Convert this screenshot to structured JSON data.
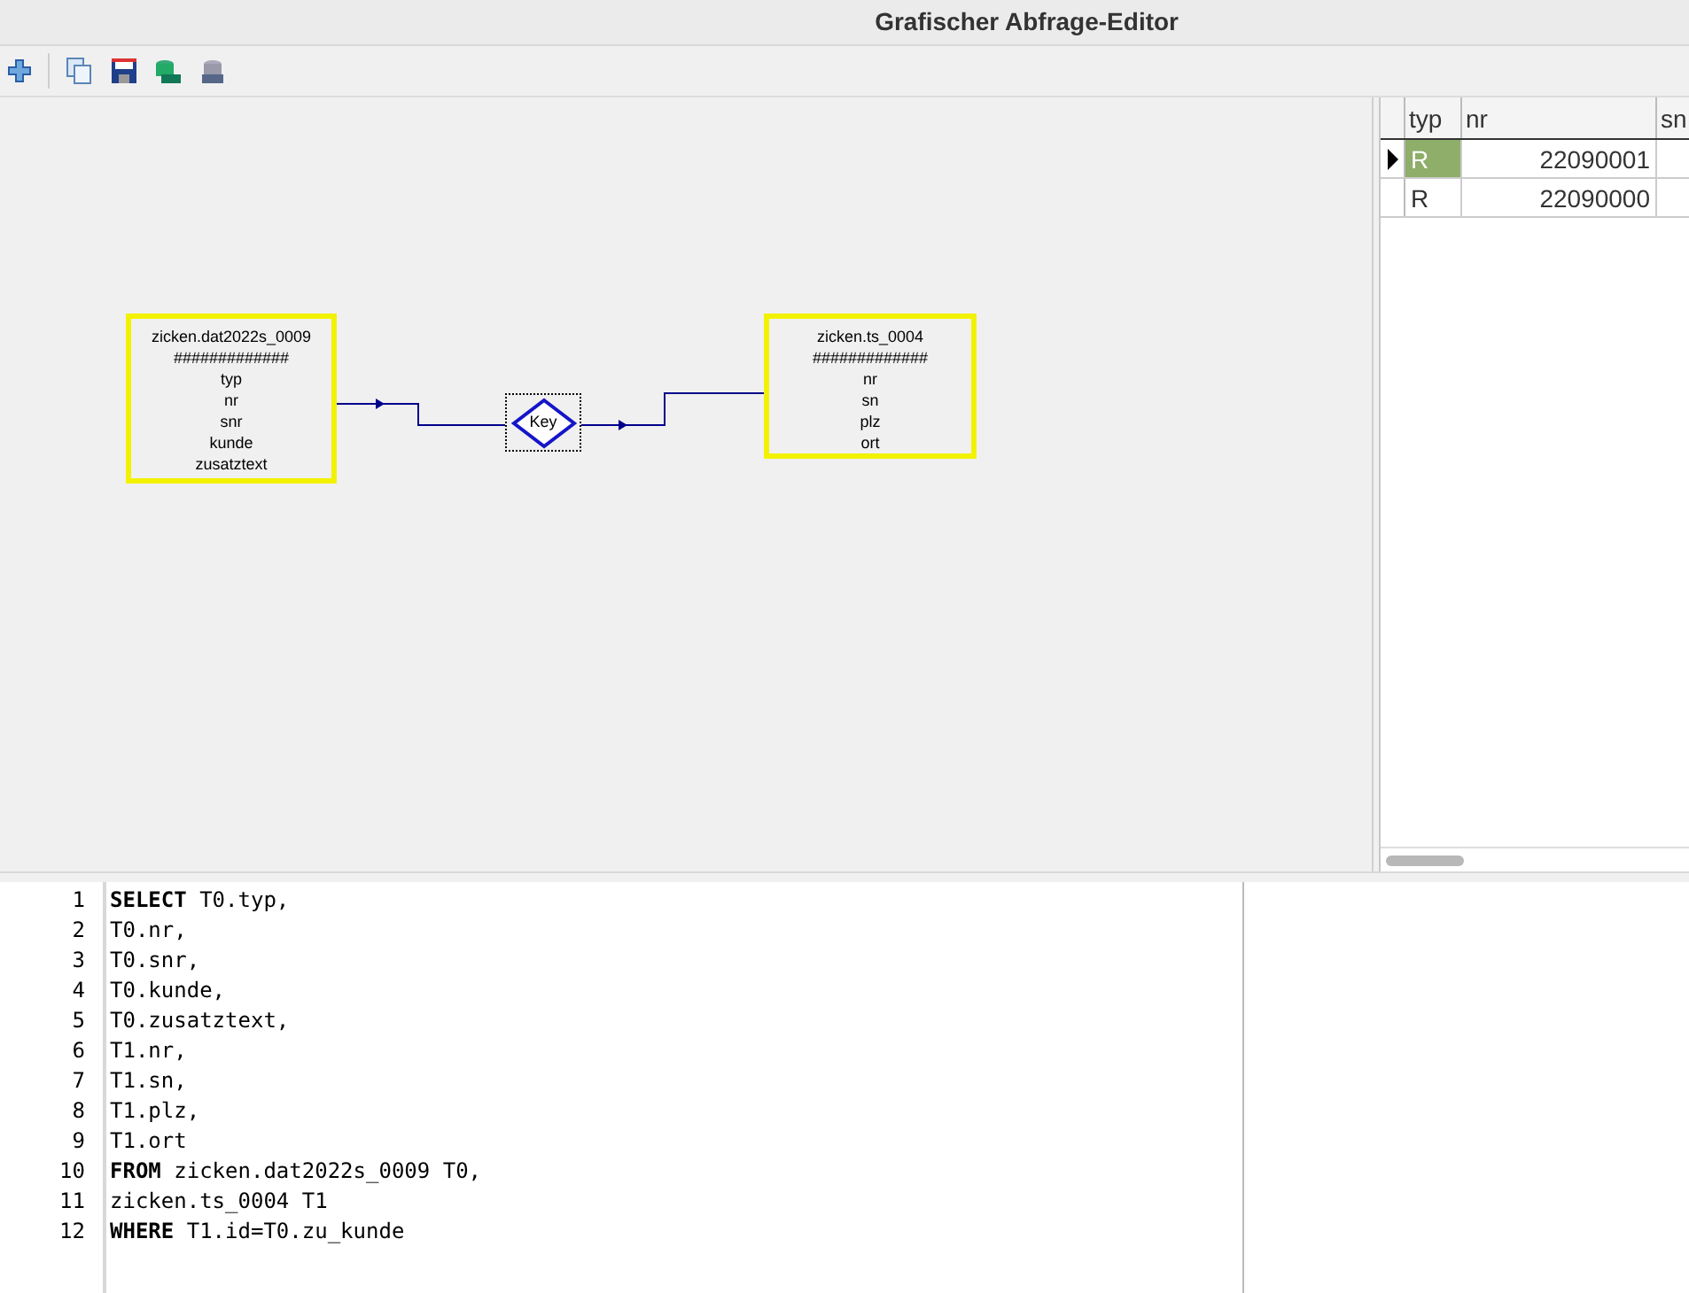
{
  "window": {
    "title": "Grafischer Abfrage-Editor"
  },
  "diagram": {
    "tables": [
      {
        "name": "zicken.dat2022s_0009",
        "separator": "#############",
        "fields": [
          "typ",
          "nr",
          "snr",
          "kunde",
          "zusatztext"
        ]
      },
      {
        "name": "zicken.ts_0004",
        "separator": "#############",
        "fields": [
          "nr",
          "sn",
          "plz",
          "ort"
        ]
      }
    ],
    "join": {
      "label": "Key"
    }
  },
  "result_grid": {
    "columns": [
      "typ",
      "nr",
      "sn"
    ],
    "rows": [
      {
        "cells": [
          "R",
          "22090001"
        ],
        "selected": true
      },
      {
        "cells": [
          "R",
          "22090000"
        ],
        "selected": false
      }
    ]
  },
  "sql_editor": {
    "lines": [
      {
        "number": "1",
        "text": "**SELECT** T0.typ,"
      },
      {
        "number": "2",
        "text": "T0.nr,"
      },
      {
        "number": "3",
        "text": "T0.snr,"
      },
      {
        "number": "4",
        "text": "T0.kunde,"
      },
      {
        "number": "5",
        "text": "T0.zusatztext,"
      },
      {
        "number": "6",
        "text": "T1.nr,"
      },
      {
        "number": "7",
        "text": "T1.sn,"
      },
      {
        "number": "8",
        "text": "T1.plz,"
      },
      {
        "number": "9",
        "text": "T1.ort"
      },
      {
        "number": "10",
        "text": "**FROM** zicken.dat2022s_0009 T0,"
      },
      {
        "number": "11",
        "text": "zicken.ts_0004 T1"
      },
      {
        "number": "12",
        "text": "**WHERE** T1.id=T0.zu_kunde"
      }
    ]
  }
}
